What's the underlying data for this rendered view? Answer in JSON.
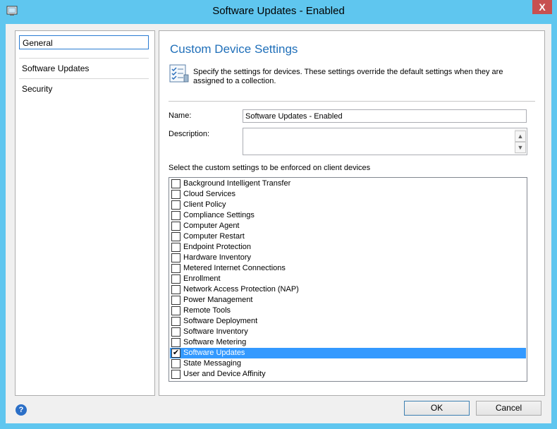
{
  "window": {
    "title": "Software Updates - Enabled",
    "close": "X"
  },
  "nav": {
    "items": [
      {
        "label": "General",
        "selected": true
      },
      {
        "label": "Software Updates",
        "selected": false
      },
      {
        "label": "Security",
        "selected": false
      }
    ]
  },
  "content": {
    "heading": "Custom Device Settings",
    "intro": "Specify the settings for devices. These settings override the default settings when they are assigned to a collection.",
    "name_label": "Name:",
    "name_value": "Software Updates - Enabled",
    "description_label": "Description:",
    "description_value": "",
    "list_label": "Select the custom settings to be enforced on client devices",
    "settings": [
      {
        "label": "Background Intelligent Transfer",
        "checked": false,
        "selected": false
      },
      {
        "label": "Cloud Services",
        "checked": false,
        "selected": false
      },
      {
        "label": "Client Policy",
        "checked": false,
        "selected": false
      },
      {
        "label": "Compliance Settings",
        "checked": false,
        "selected": false
      },
      {
        "label": "Computer Agent",
        "checked": false,
        "selected": false
      },
      {
        "label": "Computer Restart",
        "checked": false,
        "selected": false
      },
      {
        "label": "Endpoint Protection",
        "checked": false,
        "selected": false
      },
      {
        "label": "Hardware Inventory",
        "checked": false,
        "selected": false
      },
      {
        "label": "Metered Internet Connections",
        "checked": false,
        "selected": false
      },
      {
        "label": "Enrollment",
        "checked": false,
        "selected": false
      },
      {
        "label": "Network Access Protection (NAP)",
        "checked": false,
        "selected": false
      },
      {
        "label": "Power Management",
        "checked": false,
        "selected": false
      },
      {
        "label": "Remote Tools",
        "checked": false,
        "selected": false
      },
      {
        "label": "Software Deployment",
        "checked": false,
        "selected": false
      },
      {
        "label": "Software Inventory",
        "checked": false,
        "selected": false
      },
      {
        "label": "Software Metering",
        "checked": false,
        "selected": false
      },
      {
        "label": "Software Updates",
        "checked": true,
        "selected": true
      },
      {
        "label": "State Messaging",
        "checked": false,
        "selected": false
      },
      {
        "label": "User and Device Affinity",
        "checked": false,
        "selected": false
      }
    ]
  },
  "footer": {
    "help": "?",
    "ok_label": "OK",
    "cancel_label": "Cancel"
  },
  "colors": {
    "titlebar": "#5fc6ef",
    "close": "#c75050",
    "heading": "#1f6fb9",
    "selection": "#3399ff"
  }
}
